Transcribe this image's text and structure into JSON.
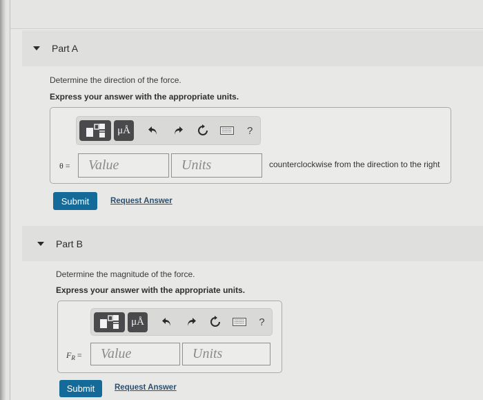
{
  "parts": [
    {
      "title": "Part A",
      "question": "Determine the direction of the force.",
      "instruction": "Express your answer with the appropriate units.",
      "toolbar": {
        "templates_icon": "templates-icon",
        "units_label": "μÅ",
        "undo_icon": "undo-icon",
        "redo_icon": "redo-icon",
        "reset_icon": "reset-icon",
        "keyboard_icon": "keyboard-icon",
        "help_label": "?"
      },
      "variable_label": "θ =",
      "value_placeholder": "Value",
      "units_placeholder": "Units",
      "suffix_text": "counterclockwise from the direction to the right",
      "submit_label": "Submit",
      "request_label": "Request Answer"
    },
    {
      "title": "Part B",
      "question": "Determine the magnitude of the force.",
      "instruction": "Express your answer with the appropriate units.",
      "toolbar": {
        "templates_icon": "templates-icon",
        "units_label": "μÅ",
        "undo_icon": "undo-icon",
        "redo_icon": "redo-icon",
        "reset_icon": "reset-icon",
        "keyboard_icon": "keyboard-icon",
        "help_label": "?"
      },
      "variable_symbol": "F",
      "variable_subscript": "R",
      "variable_eq": " =",
      "value_placeholder": "Value",
      "units_placeholder": "Units",
      "submit_label": "Submit",
      "request_label": "Request Answer"
    }
  ],
  "colors": {
    "submit_bg": "#146b99",
    "link": "#2c4f6d",
    "toolbar_dark": "#4a4a4c"
  }
}
